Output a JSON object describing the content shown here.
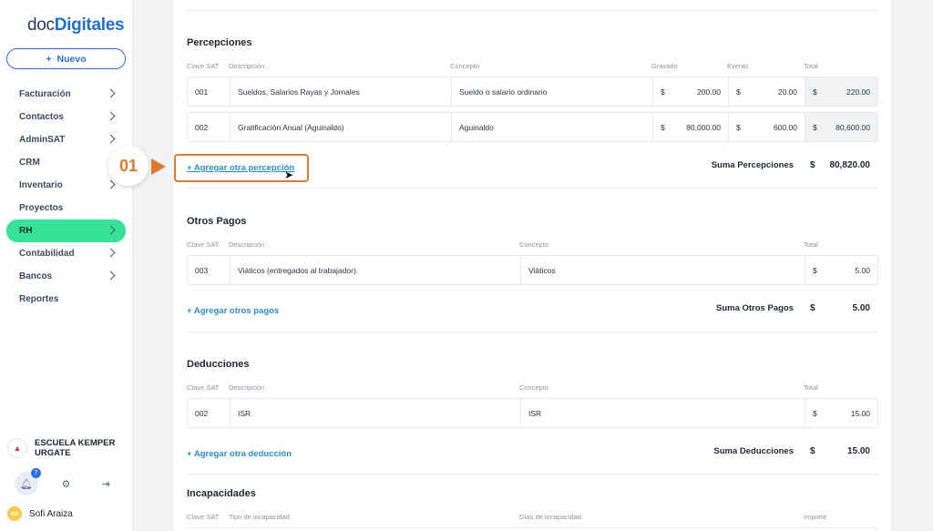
{
  "sidebar": {
    "logo_prefix": "doc",
    "logo_brand": "Digitales",
    "new_button": "Nuevo",
    "items": [
      {
        "label": "Facturación",
        "chevron": true
      },
      {
        "label": "Contactos",
        "chevron": true
      },
      {
        "label": "AdminSAT",
        "chevron": true
      },
      {
        "label": "CRM",
        "chevron": false
      },
      {
        "label": "Inventario",
        "chevron": true
      },
      {
        "label": "Proyectos",
        "chevron": false
      },
      {
        "label": "RH",
        "chevron": true,
        "active": true
      },
      {
        "label": "Contabilidad",
        "chevron": true
      },
      {
        "label": "Bancos",
        "chevron": true
      },
      {
        "label": "Reportes",
        "chevron": false
      }
    ],
    "company": "ESCUELA KEMPER URGATE",
    "notifications_count": "7",
    "user_initials": "SA",
    "user_name": "Sofi Araiza"
  },
  "percepciones": {
    "title": "Percepciones",
    "headers": {
      "clave": "Clave SAT",
      "descripcion": "Descripción",
      "concepto": "Concepto",
      "gravado": "Gravado",
      "exento": "Exento",
      "total": "Total"
    },
    "rows": [
      {
        "clave": "001",
        "descripcion": "Sueldos, Salarios Rayas y Jornales",
        "concepto": "Sueldo o salario ordinario",
        "gravado": "200.00",
        "exento": "20.00",
        "total": "220.00"
      },
      {
        "clave": "002",
        "descripcion": "Gratificación Anual (Aguinaldo)",
        "concepto": "Aguinaldo",
        "gravado": "80,000.00",
        "exento": "600.00",
        "total": "80,600.00"
      }
    ],
    "add_link": "+ Agregar otra percepción",
    "sum_label": "Suma Percepciones",
    "sum_value": "80,820.00"
  },
  "otros_pagos": {
    "title": "Otros Pagos",
    "headers": {
      "clave": "Clave SAT",
      "descripcion": "Descripción",
      "concepto": "Concepto",
      "total": "Total"
    },
    "rows": [
      {
        "clave": "003",
        "descripcion": "Viáticos (entregados al trabajador).",
        "concepto": "Viáticos",
        "total": "5.00"
      }
    ],
    "add_link": "+ Agregar otros pagos",
    "sum_label": "Suma Otros Pagos",
    "sum_value": "5.00"
  },
  "deducciones": {
    "title": "Deducciones",
    "headers": {
      "clave": "Clave SAT",
      "descripcion": "Descripción",
      "concepto": "Concepto",
      "total": "Total"
    },
    "rows": [
      {
        "clave": "002",
        "descripcion": "ISR",
        "concepto": "ISR",
        "total": "15.00"
      }
    ],
    "add_link": "+ Agregar otra deducción",
    "sum_label": "Suma Deducciones",
    "sum_value": "15.00"
  },
  "incapacidades": {
    "title": "Incapacidades",
    "headers": {
      "clave": "Clave SAT",
      "tipo": "Tipo de incapacidad",
      "dias": "Días de incapacidad",
      "importe": "Importe"
    }
  },
  "currency_symbol": "$",
  "callout": {
    "step": "01",
    "color": "#e07a2a"
  },
  "colors": {
    "accent": "#2f6fe0",
    "active_nav": "#35e396",
    "link": "#2a8fc9"
  }
}
